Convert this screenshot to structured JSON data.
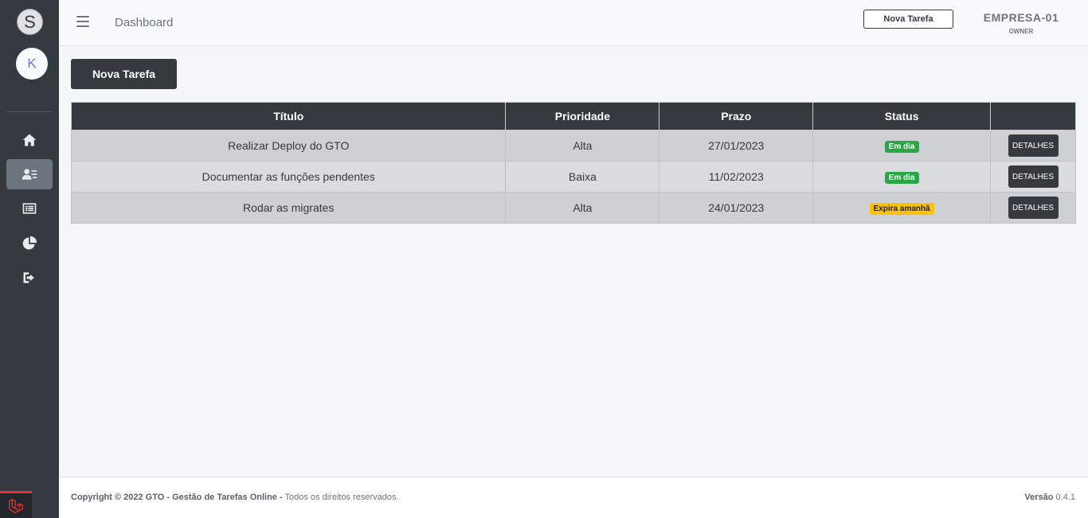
{
  "sidebar": {
    "brand_letter": "S",
    "user_initial": "K",
    "nav": [
      {
        "icon": "home-icon"
      },
      {
        "icon": "user-card-icon",
        "active": true
      },
      {
        "icon": "list-icon"
      },
      {
        "icon": "pie-chart-icon"
      },
      {
        "icon": "sign-out-icon"
      }
    ]
  },
  "header": {
    "breadcrumb": "Dashboard",
    "new_task_label": "Nova Tarefa",
    "company_name": "EMPRESA-01",
    "company_role": "OWNER"
  },
  "main": {
    "new_task_label": "Nova Tarefa",
    "table": {
      "headers": [
        "Título",
        "Prioridade",
        "Prazo",
        "Status",
        ""
      ],
      "rows": [
        {
          "title": "Realizar Deploy do GTO",
          "priority": "Alta",
          "deadline": "27/01/2023",
          "status": "Em dia",
          "status_color": "#28a745",
          "action": "DETALHES"
        },
        {
          "title": "Documentar as funções pendentes",
          "priority": "Baixa",
          "deadline": "11/02/2023",
          "status": "Em dia",
          "status_color": "#28a745",
          "action": "DETALHES"
        },
        {
          "title": "Rodar as migrates",
          "priority": "Alta",
          "deadline": "24/01/2023",
          "status": "Expira amanhã",
          "status_color": "#ffc107",
          "action": "DETALHES"
        }
      ]
    }
  },
  "footer": {
    "copyright": "Copyright © 2022 GTO - Gestão de Tarefas Online -",
    "rights": " Todos os direitos reservados.",
    "version_label": "Versão",
    "version": " 0.4.1"
  },
  "colors": {
    "sidebar": "#343a40",
    "accent_dark": "#343a40",
    "success": "#28a745",
    "warning": "#ffc107"
  }
}
